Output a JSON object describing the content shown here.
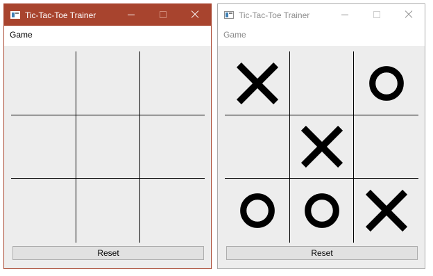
{
  "windows": [
    {
      "title": "Tic-Tac-Toe Trainer",
      "menu": {
        "game_label": "Game"
      },
      "board": [
        "",
        "",
        "",
        "",
        "",
        "",
        "",
        "",
        ""
      ],
      "reset_label": "Reset",
      "active": true
    },
    {
      "title": "Tic-Tac-Toe Trainer",
      "menu": {
        "game_label": "Game"
      },
      "board": [
        "X",
        "",
        "O",
        "",
        "X",
        "",
        "O",
        "O",
        "X"
      ],
      "reset_label": "Reset",
      "active": false
    }
  ],
  "icons": {
    "app": "app-window-icon",
    "minimize": "minimize-icon",
    "maximize": "maximize-icon",
    "close": "close-icon"
  },
  "colors": {
    "active_titlebar": "#a8442e",
    "inactive_titlebar": "#ffffff",
    "client_background": "#ededed",
    "mark": "#000000"
  }
}
